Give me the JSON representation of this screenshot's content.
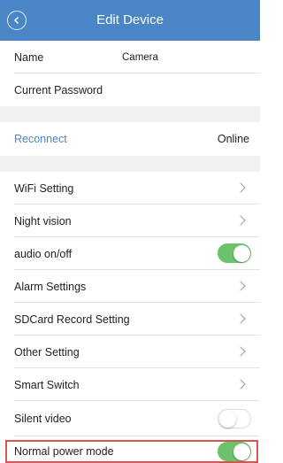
{
  "header": {
    "title": "Edit Device",
    "back_icon": "chevron-left-icon"
  },
  "info": {
    "name_label": "Name",
    "name_value": "Camera",
    "password_label": "Current Password",
    "password_placeholder": ""
  },
  "connection": {
    "reconnect_label": "Reconnect",
    "status": "Online"
  },
  "settings": {
    "wifi_label": "WiFi Setting",
    "night_vision_label": "Night vision",
    "audio_label": "audio on/off",
    "audio_on": true,
    "alarm_label": "Alarm Settings",
    "sdcard_label": "SDCard Record Setting",
    "other_label": "Other Setting",
    "smart_switch_label": "Smart Switch",
    "silent_video_label": "Silent video",
    "silent_video_on": false,
    "normal_power_label": "Normal power mode",
    "normal_power_on": true
  },
  "colors": {
    "header_bg": "#4a86c6",
    "link": "#4a86c6",
    "toggle_on": "#6cc26b",
    "highlight": "#d9534f",
    "group_gap": "#f2f2f2"
  }
}
